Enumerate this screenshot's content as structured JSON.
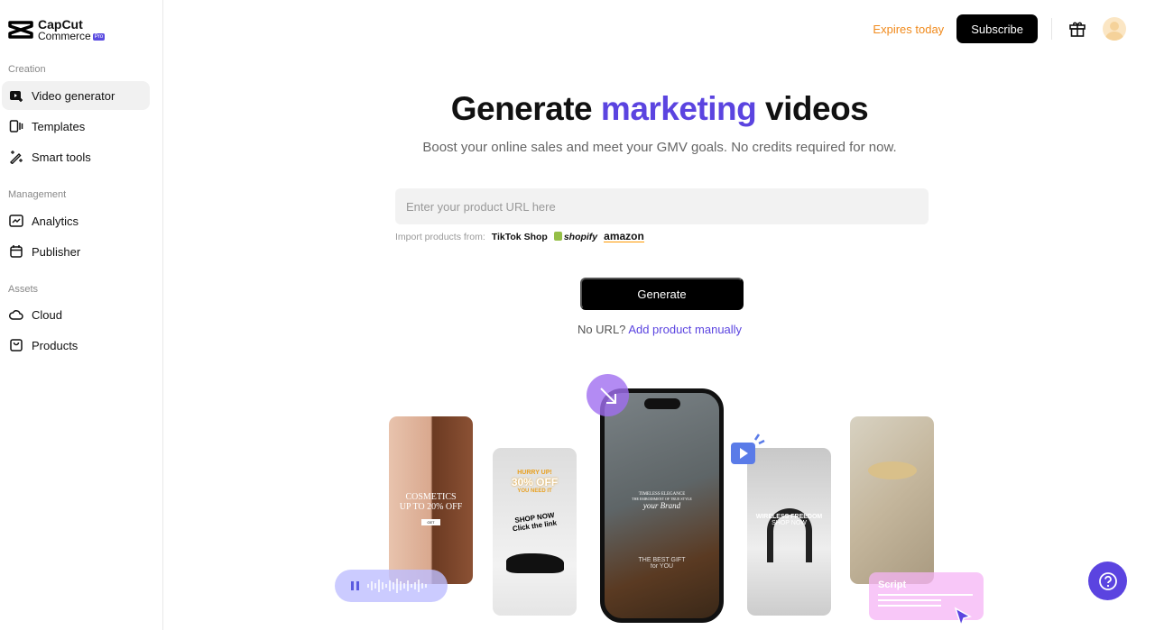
{
  "brand": {
    "line1": "CapCut",
    "line2": "Commerce",
    "badge": "Pro"
  },
  "sidebar": {
    "sections": [
      {
        "label": "Creation",
        "items": [
          {
            "label": "Video generator",
            "icon": "video-plus-icon",
            "active": true
          },
          {
            "label": "Templates",
            "icon": "templates-icon"
          },
          {
            "label": "Smart tools",
            "icon": "magic-wand-icon"
          }
        ]
      },
      {
        "label": "Management",
        "items": [
          {
            "label": "Analytics",
            "icon": "chart-icon"
          },
          {
            "label": "Publisher",
            "icon": "calendar-icon"
          }
        ]
      },
      {
        "label": "Assets",
        "items": [
          {
            "label": "Cloud",
            "icon": "cloud-icon"
          },
          {
            "label": "Products",
            "icon": "bag-icon"
          }
        ]
      }
    ]
  },
  "header": {
    "expires": "Expires today",
    "subscribe": "Subscribe",
    "gift_icon": "gift-icon",
    "avatar_icon": "user-avatar"
  },
  "hero": {
    "title_pre": "Generate ",
    "title_accent": "marketing",
    "title_post": " videos",
    "subtitle": "Boost your online sales and meet your GMV goals. No credits required for now.",
    "accent_color": "#5b44e0"
  },
  "form": {
    "url_placeholder": "Enter your product URL here",
    "import_label": "Import products from:",
    "platforms": [
      "TikTok Shop",
      "shopify",
      "amazon"
    ],
    "generate": "Generate",
    "no_url": "No URL?",
    "add_manual": "Add product manually"
  },
  "previews": {
    "cosmetics": [
      "COSMETICS",
      "UP TO 20% OFF",
      "GET"
    ],
    "sneaker": [
      "HURRY UP!",
      "30% OFF",
      "YOU NEED IT",
      "SHOP NOW",
      "Click the link"
    ],
    "main": [
      "TIMELESS ELEGANCE",
      "THE EMBODIMENT OF TRUE STYLE",
      "your Brand",
      "THE BEST GIFT",
      "for YOU"
    ],
    "headphones": [
      "WIRELESS FREEDOM",
      "SHOP NOW"
    ],
    "script": "Script"
  },
  "help_icon": "help-icon"
}
